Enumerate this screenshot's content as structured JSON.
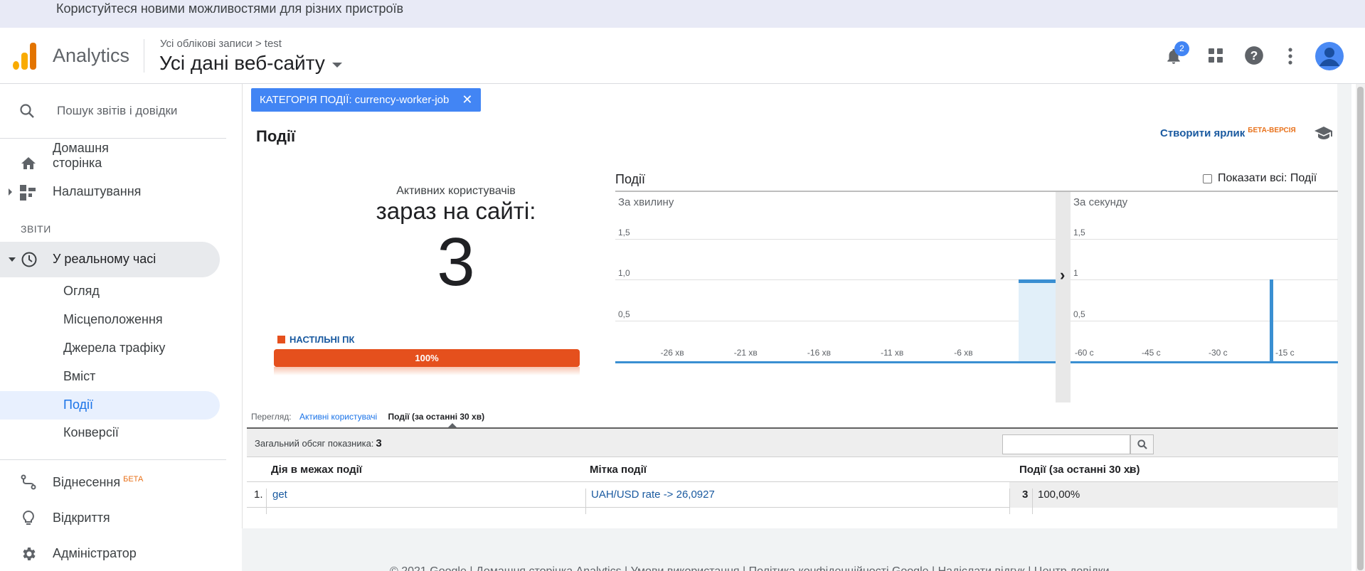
{
  "banner": {
    "text": "Користуйтеся новими можливостями для різних пристроїв"
  },
  "header": {
    "app_name": "Analytics",
    "breadcrumb": {
      "root": "Усі облікові записи",
      "separator": ">",
      "account": "test"
    },
    "property": "Усі дані веб-сайту",
    "notifications_count": "2",
    "icons": [
      "bell-icon",
      "apps-grid-icon",
      "help-icon",
      "more-vert-icon",
      "avatar"
    ]
  },
  "sidebar": {
    "search_placeholder": "Пошук звітів і довідки",
    "home_line1": "Домашня",
    "home_line2": "сторінка",
    "settings": "Налаштування",
    "reports_section": "ЗВІТИ",
    "realtime": "У реальному часі",
    "sub_items": [
      "Огляд",
      "Місцеположення",
      "Джерела трафіку",
      "Вміст",
      "Події",
      "Конверсії"
    ],
    "attribution": "Віднесення",
    "attribution_badge": "БЕТА",
    "discover": "Відкриття",
    "admin": "Адміністратор"
  },
  "filter_chip": {
    "label": "КАТЕГОРІЯ ПОДІЇ: currency-worker-job",
    "close": "✕"
  },
  "page": {
    "title": "Події",
    "shortcut_label": "Створити ярлик",
    "shortcut_badge": "БЕТА-ВЕРСІЯ"
  },
  "active_users": {
    "label": "Активних користувачів",
    "headline": "зараз на сайті:",
    "count": "3",
    "device_label": "НАСТІЛЬНІ ПК",
    "device_percent": "100%",
    "device_fraction": 1.0
  },
  "events_chart": {
    "title": "Події",
    "show_all_label": "Показати всі: Події",
    "per_minute_label": "За хвилину",
    "per_second_label": "За секунду",
    "arrow": "›"
  },
  "chart_data": [
    {
      "type": "bar",
      "title": "За хвилину",
      "y_ticks": [
        "1,5",
        "1,0",
        "0,5"
      ],
      "ylim": [
        0,
        2
      ],
      "x_ticks": [
        "-26 хв",
        "-21 хв",
        "-16 хв",
        "-11 хв",
        "-6 хв",
        "-..."
      ],
      "xlim": [
        -30,
        0
      ],
      "series": [
        {
          "x": [
            -1
          ],
          "values": [
            1
          ]
        }
      ]
    },
    {
      "type": "bar",
      "title": "За секунду",
      "y_ticks": [
        "1,5",
        "1",
        "0,5"
      ],
      "ylim": [
        0,
        2
      ],
      "x_ticks": [
        "-60 с",
        "-45 с",
        "-30 с",
        "-15 с"
      ],
      "xlim": [
        -60,
        0
      ],
      "series": [
        {
          "x": [
            -15
          ],
          "values": [
            1
          ]
        }
      ]
    }
  ],
  "view": {
    "label": "Перегляд:",
    "option_active_users": "Активні користувачі",
    "option_events": "Події (за останні 30 хв)"
  },
  "table": {
    "total_label": "Загальний обсяг показника:",
    "total_value": "3",
    "columns": [
      "Дія в межах події",
      "Мітка події",
      "Події (за останні 30 хв)"
    ],
    "sort_icon": "↓",
    "rows": [
      {
        "index": "1.",
        "action": "get",
        "label": "UAH/USD rate -> 26,0927",
        "count": "3",
        "percent": "100,00%"
      }
    ]
  },
  "footer": {
    "text": "© 2021 Google | Домашня сторінка Analytics | Умови використання | Політика конфіденційності Google | Надіслати відгук | Центр довідки"
  },
  "colors": {
    "accent": "#4285f4",
    "device": "#e5501d",
    "bar": "#3a8fd2",
    "link": "#1a5aa0"
  }
}
